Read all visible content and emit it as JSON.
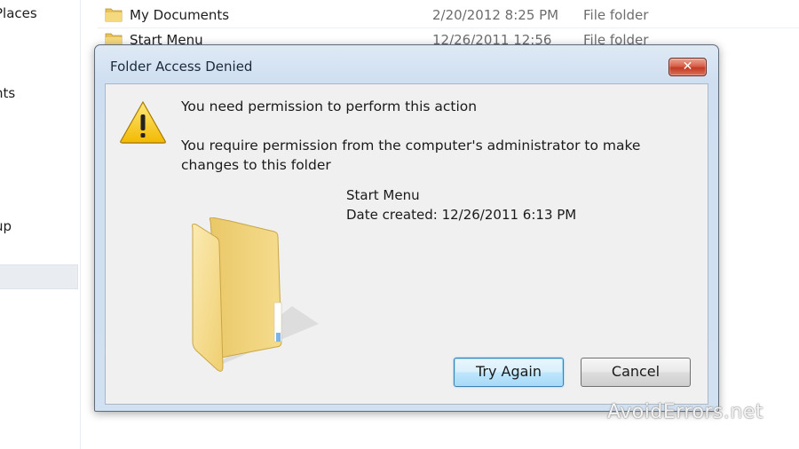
{
  "explorer": {
    "nav_items": [
      "Places",
      "nts",
      "up"
    ],
    "files": [
      {
        "name": "My Documents",
        "date": "2/20/2012 8:25 PM",
        "type": "File folder"
      },
      {
        "name": "Start Menu",
        "date": "12/26/2011 12:56",
        "type": "File folder"
      }
    ]
  },
  "dialog": {
    "title": "Folder Access Denied",
    "close_label": "✕",
    "message_main": "You need permission to perform this action",
    "message_detail": "You require permission from the computer's administrator to make changes to this folder",
    "item_name": "Start Menu",
    "item_date": "Date created: 12/26/2011 6:13 PM",
    "try_again_label": "Try Again",
    "cancel_label": "Cancel",
    "icons": {
      "warning": "warning-icon",
      "folder": "folder-icon",
      "close": "close-icon"
    }
  },
  "watermark": "AvoidErrors.net",
  "colors": {
    "dialog_frame": "#cfdff1",
    "close_button": "#c23a22",
    "default_button_border": "#3c7fb1",
    "folder_yellow": "#f2d27a"
  }
}
